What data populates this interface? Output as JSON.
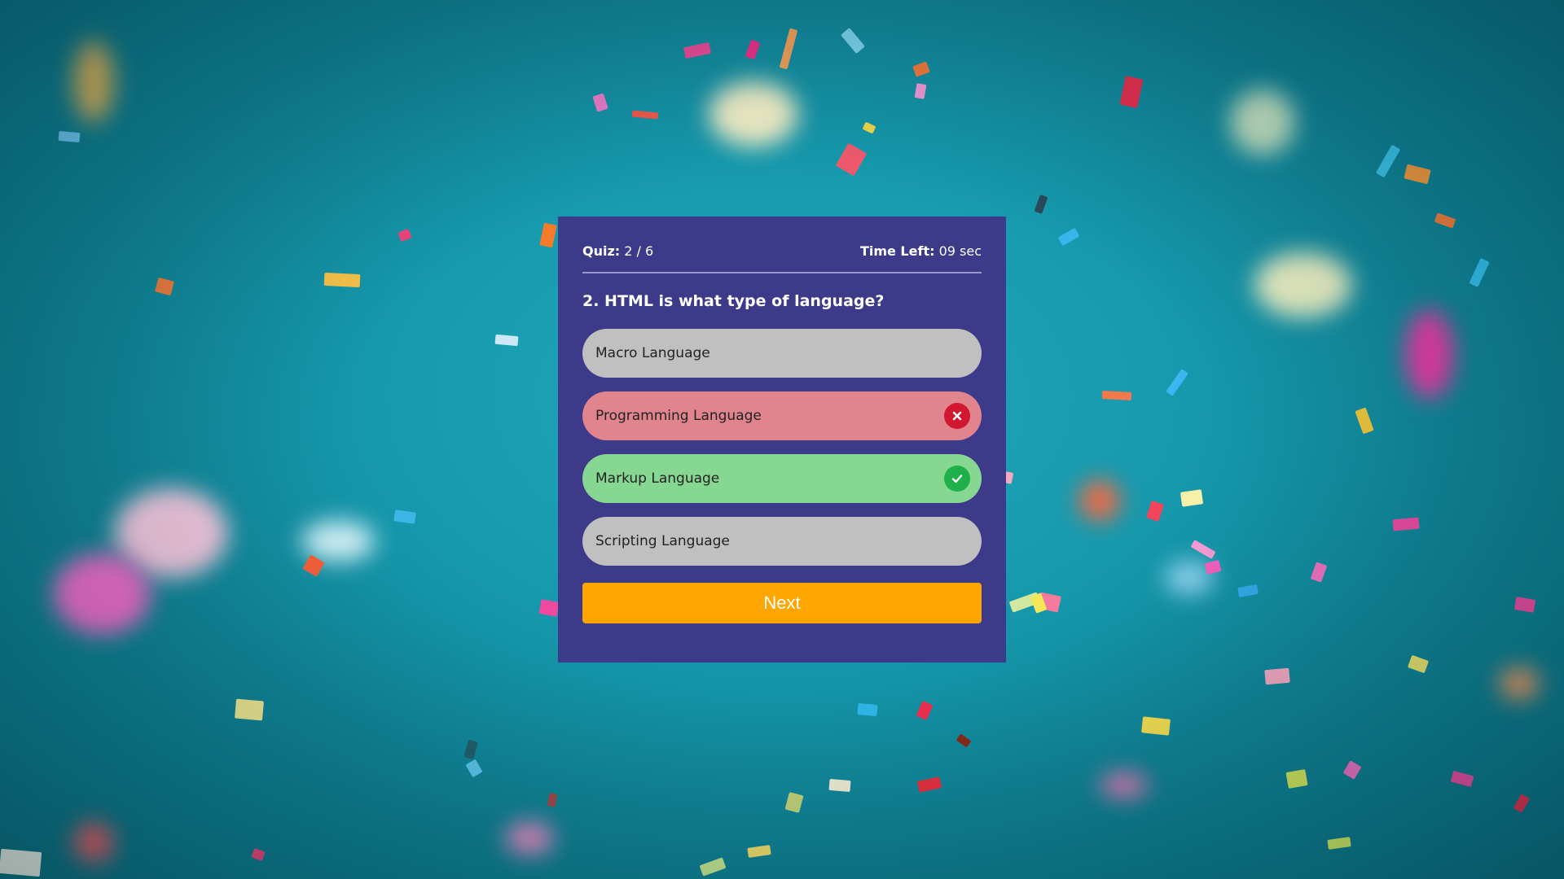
{
  "quiz": {
    "counter_label": "Quiz:",
    "counter_value": "2 / 6",
    "timer_label": "Time Left:",
    "timer_value": "09 sec"
  },
  "question": {
    "text": "2. HTML is what type of language?"
  },
  "options": [
    {
      "label": "Macro Language",
      "state": "neutral"
    },
    {
      "label": "Programming Language",
      "state": "incorrect",
      "icon": "x-mark-icon"
    },
    {
      "label": "Markup Language",
      "state": "correct",
      "icon": "check-icon"
    },
    {
      "label": "Scripting Language",
      "state": "neutral"
    }
  ],
  "next_button": {
    "label": "Next"
  },
  "colors": {
    "panel": "#3d3a8a",
    "option_neutral": "#c0c0c0",
    "option_incorrect": "#e0858d",
    "option_correct": "#86d791",
    "icon_incorrect": "#d21831",
    "icon_correct": "#1fb04a",
    "next_button": "#ffa500",
    "background": "#179aae"
  }
}
